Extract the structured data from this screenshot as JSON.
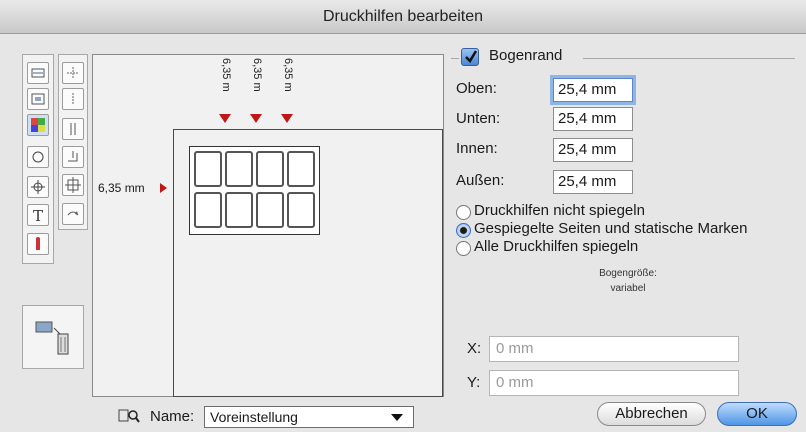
{
  "window": {
    "title": "Druckhilfen bearbeiten"
  },
  "preview": {
    "top_marks": [
      "6,35 m",
      "6,35 m",
      "6,35 m"
    ],
    "left_mark": "6,35 mm"
  },
  "bogenrand": {
    "label": "Bogenrand",
    "checked": true,
    "fields": [
      {
        "label": "Oben:",
        "value": "25,4 mm"
      },
      {
        "label": "Unten:",
        "value": "25,4 mm"
      },
      {
        "label": "Innen:",
        "value": "25,4 mm"
      },
      {
        "label": "Außen:",
        "value": "25,4 mm"
      }
    ]
  },
  "mirroring": {
    "options": [
      "Druckhilfen nicht spiegeln",
      "Gespiegelte Seiten und statische Marken",
      "Alle Druckhilfen spiegeln"
    ],
    "selected_index": 1
  },
  "sheet_size": {
    "label": "Bogengröße:",
    "value": "variabel"
  },
  "position": {
    "x_label": "X:",
    "x_value": "0 mm",
    "y_label": "Y:",
    "y_value": "0 mm"
  },
  "name": {
    "label": "Name:",
    "value": "Voreinstellung"
  },
  "buttons": {
    "cancel": "Abbrechen",
    "ok": "OK"
  },
  "colors": {
    "marker_red": "#c01818",
    "accent_blue": "#4f95e6"
  }
}
